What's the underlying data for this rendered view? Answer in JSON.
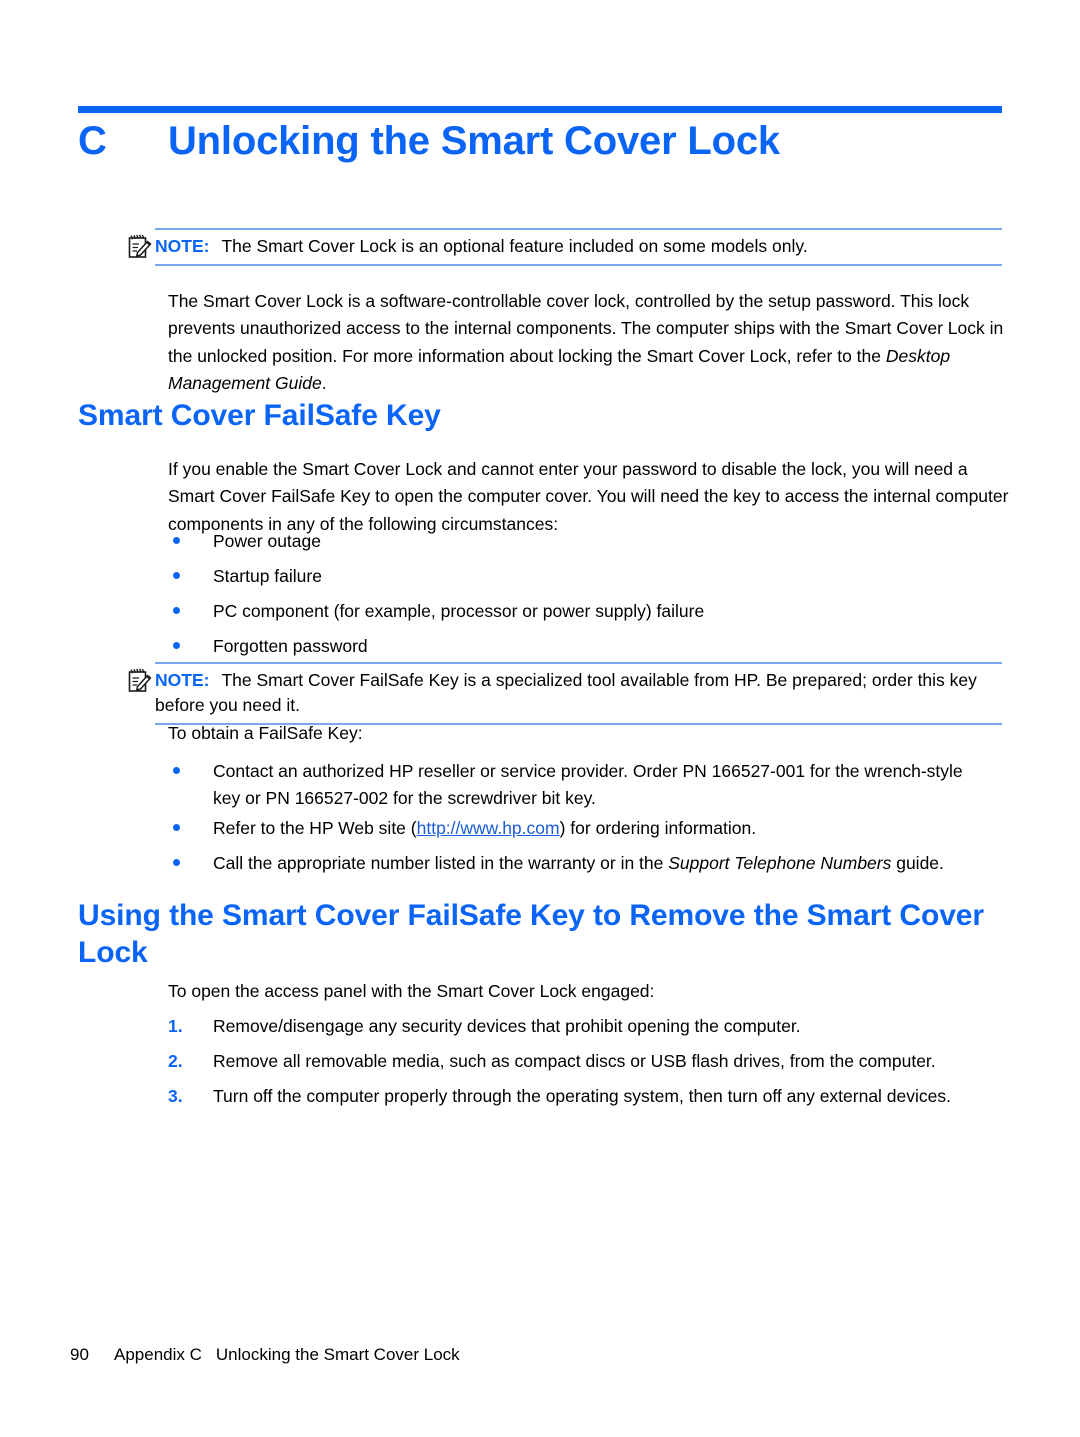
{
  "colors": {
    "accent_blue": "#0a64f5",
    "note_rule": "#7ba7e8",
    "link_blue": "#1a5cd6",
    "body_text": "#000000"
  },
  "chapter": {
    "letter": "C",
    "title": "Unlocking the Smart Cover Lock"
  },
  "notes": [
    {
      "icon": "note-pad-pencil-icon",
      "label": "NOTE:",
      "text": "The Smart Cover Lock is an optional feature included on some models only."
    },
    {
      "icon": "note-pad-pencil-icon",
      "label": "NOTE:",
      "text": "The Smart Cover FailSafe Key is a specialized tool available from HP. Be prepared; order this key before you need it."
    }
  ],
  "intro_paragraph": {
    "before_italic": "The Smart Cover Lock is a software-controllable cover lock, controlled by the setup password. This lock prevents unauthorized access to the internal components. The computer ships with the Smart Cover Lock in the unlocked position. For more information about locking the Smart Cover Lock, refer to the ",
    "italic": "Desktop Management Guide",
    "after_italic": "."
  },
  "section_failsafe": {
    "heading": "Smart Cover FailSafe Key",
    "paragraph": "If you enable the Smart Cover Lock and cannot enter your password to disable the lock, you will need a Smart Cover FailSafe Key to open the computer cover. You will need the key to access the internal computer components in any of the following circumstances:",
    "bullets": [
      "Power outage",
      "Startup failure",
      "PC component (for example, processor or power supply) failure",
      "Forgotten password"
    ],
    "obtain_lead": "To obtain a FailSafe Key:",
    "obtain_bullets": [
      {
        "id": "contact-reseller",
        "text": "Contact an authorized HP reseller or service provider. Order PN 166527-001 for the wrench-style key or PN 166527-002 for the screwdriver bit key."
      },
      {
        "id": "hp-web-site",
        "before_link": "Refer to the HP Web site (",
        "link_text": "http://www.hp.com",
        "after_link": ") for ordering information."
      },
      {
        "id": "call-number",
        "before_italic": "Call the appropriate number listed in the warranty or in the ",
        "italic": "Support Telephone Numbers",
        "after_italic": " guide."
      }
    ]
  },
  "section_using": {
    "heading": "Using the Smart Cover FailSafe Key to Remove the Smart Cover Lock",
    "lead": "To open the access panel with the Smart Cover Lock engaged:",
    "steps": [
      {
        "number": "1.",
        "text": "Remove/disengage any security devices that prohibit opening the computer."
      },
      {
        "number": "2.",
        "text": "Remove all removable media, such as compact discs or USB flash drives, from the computer."
      },
      {
        "number": "3.",
        "text": "Turn off the computer properly through the operating system, then turn off any external devices."
      }
    ]
  },
  "footer": {
    "page_number": "90",
    "appendix": "Appendix C",
    "title": "Unlocking the Smart Cover Lock"
  }
}
